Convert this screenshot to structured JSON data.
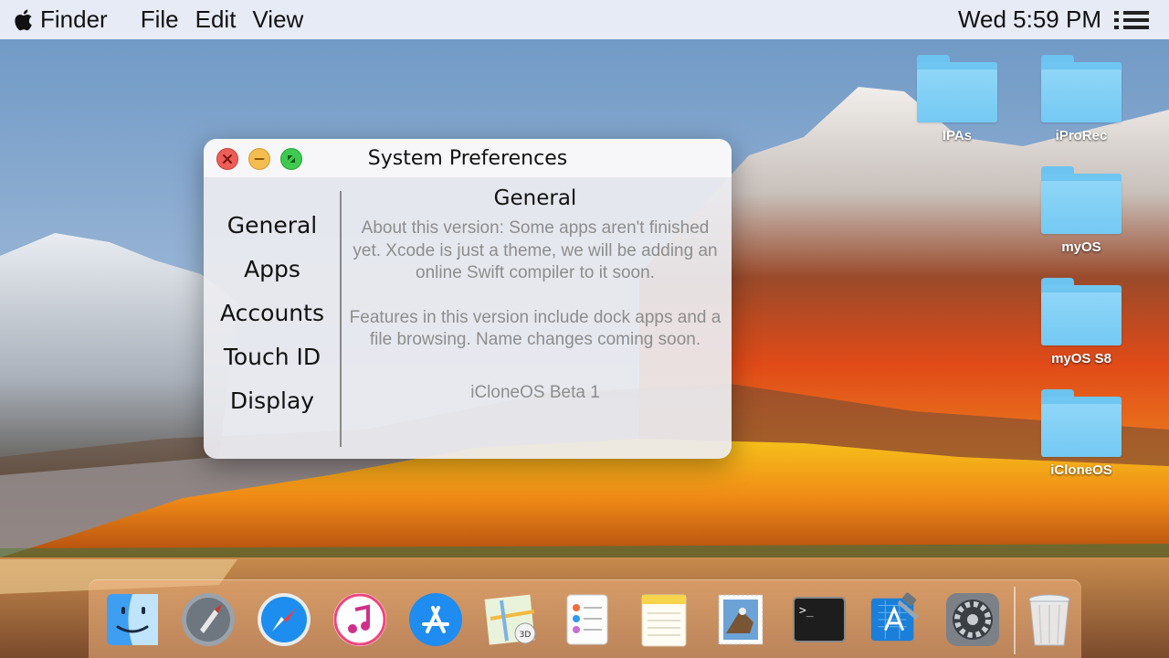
{
  "menubar": {
    "app_name": "Finder",
    "menus": [
      "File",
      "Edit",
      "View"
    ],
    "clock": "Wed 5:59 PM"
  },
  "desktop": {
    "icons": [
      {
        "label": "IPAs"
      },
      {
        "label": "iProRec"
      },
      {
        "label": "myOS"
      },
      {
        "label": "myOS S8"
      },
      {
        "label": "iCloneOS"
      }
    ]
  },
  "window": {
    "title": "System Preferences",
    "sidebar": [
      "General",
      "Apps",
      "Accounts",
      "Touch ID",
      "Display"
    ],
    "content": {
      "heading": "General",
      "about": "About this version: Some apps aren't finished yet. Xcode is just a theme, we will be adding an online Swift compiler to it soon.",
      "features": "Features in this version include dock apps and a file browsing. Name changes coming soon.",
      "version": "iCloneOS Beta 1"
    }
  },
  "dock": {
    "apps": [
      "finder-icon",
      "launchpad-icon",
      "safari-icon",
      "itunes-icon",
      "app-store-icon",
      "maps-icon",
      "reminders-icon",
      "notes-icon",
      "mail-icon",
      "terminal-icon",
      "xcode-icon",
      "system-preferences-icon",
      "trash-icon"
    ]
  },
  "colors": {
    "close": "#ec5f59",
    "minimize": "#f5bd4f",
    "zoom": "#3fc950",
    "folder": "#74c9f3"
  }
}
